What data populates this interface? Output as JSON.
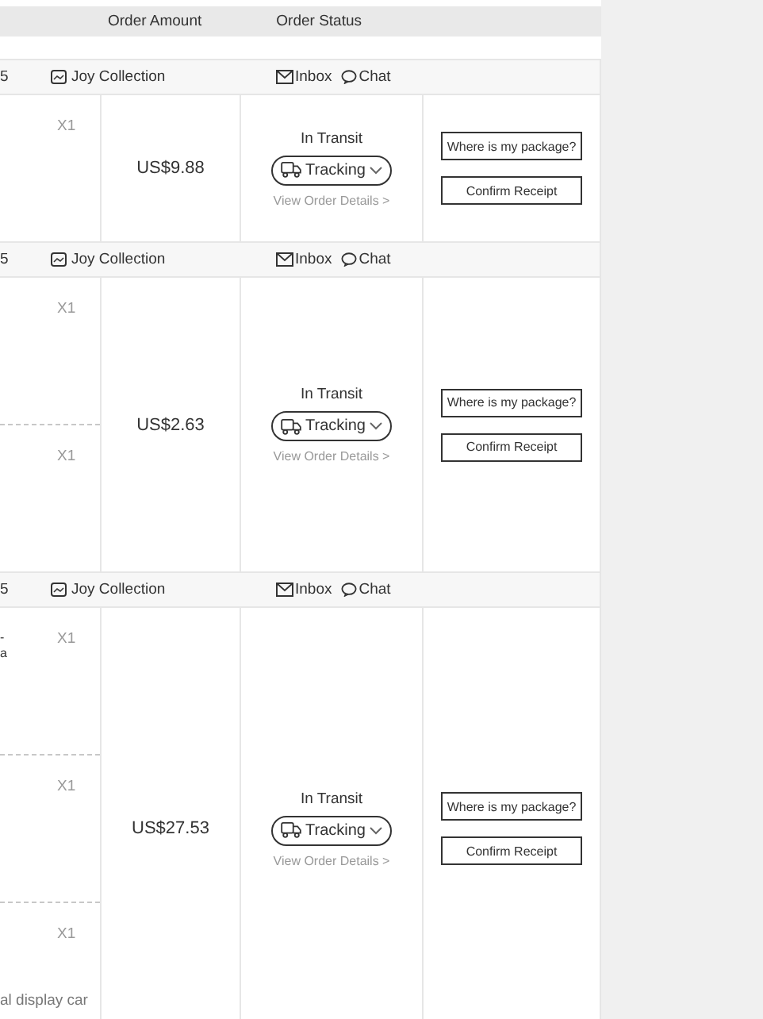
{
  "table_header": {
    "columns": [
      "Order Amount",
      "Order Status"
    ]
  },
  "orders": [
    {
      "order_fragment": "5",
      "store": "Joy Collection",
      "inbox": "Inbox",
      "chat": "Chat",
      "amount": "US$9.88",
      "status": "In Transit",
      "tracking": "Tracking",
      "details_link": "View Order Details >",
      "actions": [
        "Where is my package?",
        "Confirm Receipt"
      ],
      "items": [
        {
          "quantity": "X1"
        }
      ]
    },
    {
      "order_fragment": "5",
      "store": "Joy Collection",
      "inbox": "Inbox",
      "chat": "Chat",
      "amount": "US$2.63",
      "status": "In Transit",
      "tracking": "Tracking",
      "details_link": "View Order Details >",
      "actions": [
        "Where is my package?",
        "Confirm Receipt"
      ],
      "items": [
        {
          "quantity": "X1"
        },
        {
          "quantity": "X1"
        }
      ]
    },
    {
      "order_fragment": "5",
      "store": "Joy Collection",
      "inbox": "Inbox",
      "chat": "Chat",
      "amount": "US$27.53",
      "status": "In Transit",
      "tracking": "Tracking",
      "details_link": "View Order Details >",
      "actions": [
        "Where is my package?",
        "Confirm Receipt"
      ],
      "items": [
        {
          "quantity": "X1",
          "name_lines": [
            "-",
            "a"
          ]
        },
        {
          "quantity": "X1"
        },
        {
          "quantity": "X1",
          "note": "al display car"
        }
      ]
    }
  ]
}
